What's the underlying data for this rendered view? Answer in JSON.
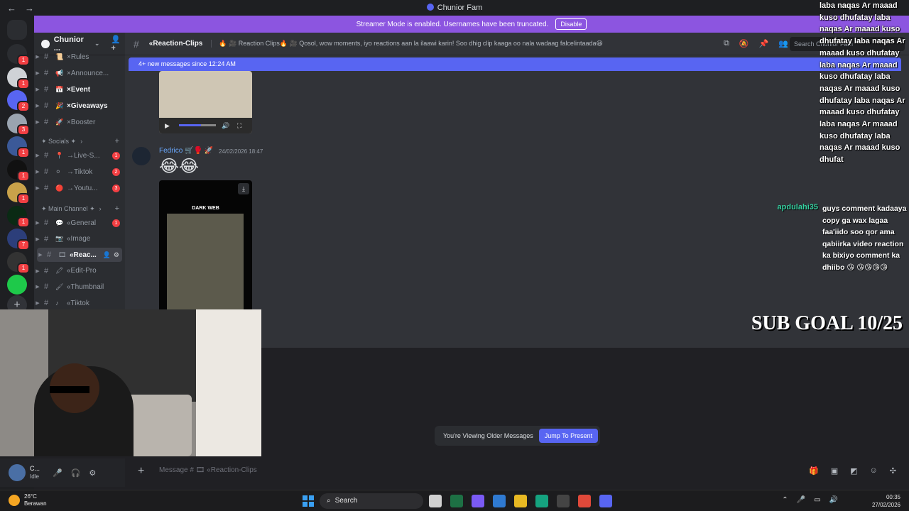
{
  "window": {
    "title": "Chunior Fam"
  },
  "streamer_bar": {
    "text": "Streamer Mode is enabled. Usernames have been truncated.",
    "disable_label": "Disable"
  },
  "server": {
    "name": "Chunior ..."
  },
  "guilds": [
    {
      "color": "#2b2d31",
      "badge": "1"
    },
    {
      "color": "#cfd2d6",
      "badge": "1"
    },
    {
      "color": "#5865f2",
      "badge": "2"
    },
    {
      "color": "#9aa4b0",
      "badge": "3"
    },
    {
      "color": "#3b5998",
      "badge": "1"
    },
    {
      "color": "#111111",
      "badge": "1"
    },
    {
      "color": "#c9a24a",
      "badge": "1"
    },
    {
      "color": "#0a2a14",
      "badge": "1"
    },
    {
      "color": "#2c3e7a",
      "badge": "7"
    },
    {
      "color": "#333333",
      "badge": "1"
    },
    {
      "color": "#1ec94a",
      "badge": ""
    }
  ],
  "channels": {
    "items": [
      {
        "emoji": "📜",
        "name": "×Rules",
        "badge": ""
      },
      {
        "emoji": "📢",
        "name": "×Announce...",
        "badge": ""
      },
      {
        "emoji": "📅",
        "name": "×Event",
        "badge": "",
        "bright": true
      },
      {
        "emoji": "🎉",
        "name": "×Giveaways",
        "badge": "",
        "bright": true
      },
      {
        "emoji": "🚀",
        "name": "×Booster",
        "badge": ""
      }
    ],
    "cat_socials": "✦ Socials ✦",
    "socials": [
      {
        "emoji": "📍",
        "name": "→Live-S...",
        "badge": "1"
      },
      {
        "emoji": "⚪",
        "name": "→Tiktok",
        "badge": "2"
      },
      {
        "emoji": "🔴",
        "name": "→Youtu...",
        "badge": "3"
      }
    ],
    "cat_main": "✦ Main Channel ✦",
    "main": [
      {
        "emoji": "💬",
        "name": "«General",
        "badge": "1"
      },
      {
        "emoji": "📷",
        "name": "«Image",
        "badge": ""
      },
      {
        "emoji": "🎞",
        "name": "«Reac...",
        "badge": "",
        "active": true
      },
      {
        "emoji": "🖍",
        "name": "«Edit-Pro",
        "badge": ""
      },
      {
        "emoji": "🖌",
        "name": "«Thumbnail",
        "badge": ""
      },
      {
        "emoji": "♪",
        "name": "«Tiktok",
        "badge": ""
      }
    ]
  },
  "chat": {
    "channel_name": "«Reaction-Clips",
    "topic": "🔥 🎥 Reaction Clips🔥 🎥 Qosol, wow moments, iyo reactions aan la ilaawi karin! Soo dhig clip kaaga oo nala wadaag falcelintaada😆",
    "search_placeholder": "Search Chunior Fam",
    "new_messages": "4+ new messages since 12:24 AM",
    "author": "Fedrico 🛒🥊 🚀",
    "timestamp": "24/02/2026 18:47",
    "emoji": "😂😂",
    "video2_caption": "DARK WEB",
    "older_text": "You're Viewing Older Messages",
    "jump_label": "Jump To Present",
    "composer_placeholder": "Message # 🎞 «Reaction-Clips"
  },
  "user_panel": {
    "name": "C...",
    "status": "Idle"
  },
  "overlay": {
    "stream_chat": "laba naqas Ar maaad kuso dhufatay laba naqas Ar maaad kuso dhufatay laba naqas Ar maaad kuso dhufatay laba naqas Ar maaad kuso dhufatay laba naqas Ar maaad kuso dhufatay laba naqas Ar maaad kuso dhufatay laba naqas Ar maaad kuso dhufatay laba naqas Ar maaad kuso dhufat",
    "username": "apdulahi35",
    "message": "guys comment kadaaya copy ga wax lagaa faa'iido soo qor ama qabiirka video reaction ka bixiyo comment ka dhiibo 😘 😘😘😘😘",
    "sub_goal": "SUB GOAL 10/25"
  },
  "taskbar": {
    "temp": "26°C",
    "weather": "Berawan",
    "search": "Search",
    "time": "00:35",
    "date": "27/02/2026"
  }
}
